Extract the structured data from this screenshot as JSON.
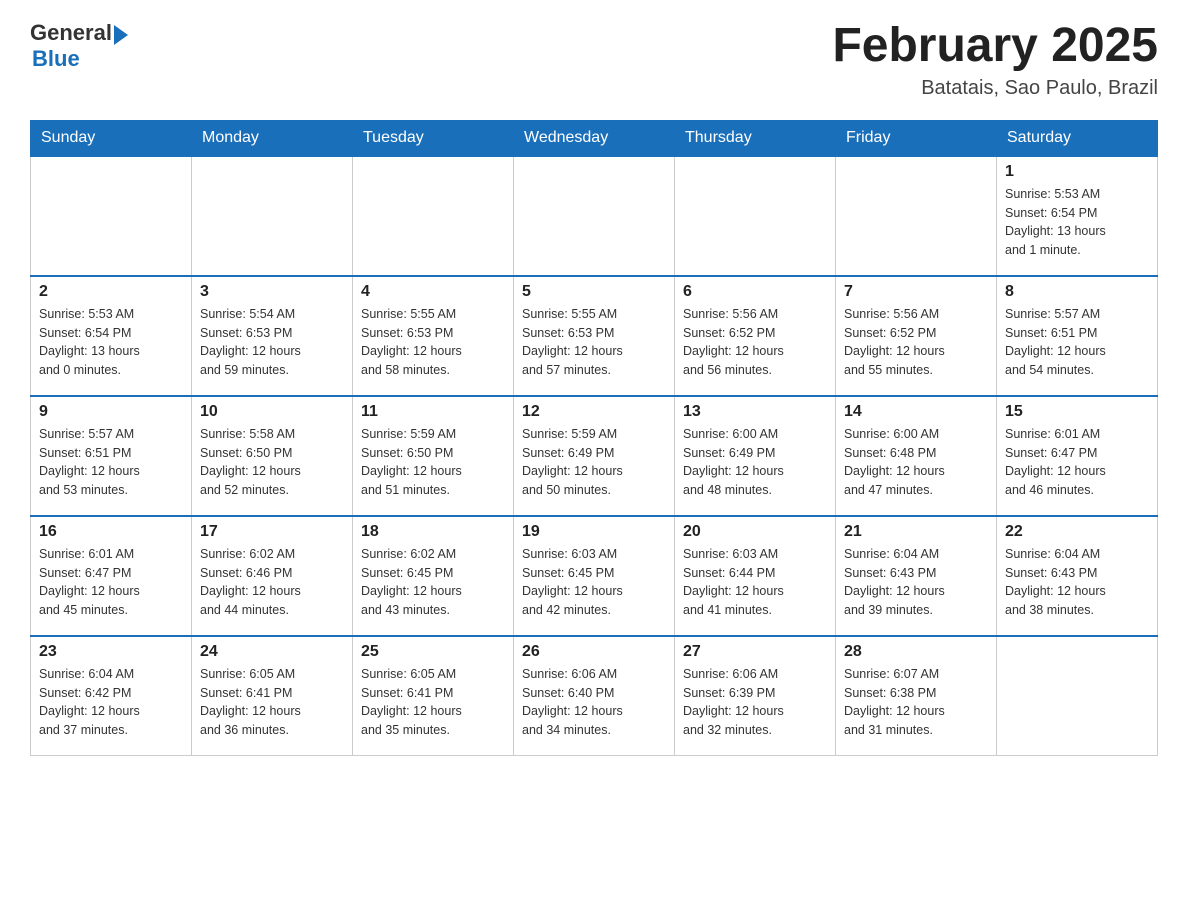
{
  "header": {
    "logo_general": "General",
    "logo_blue": "Blue",
    "month_title": "February 2025",
    "location": "Batatais, Sao Paulo, Brazil"
  },
  "days_of_week": [
    "Sunday",
    "Monday",
    "Tuesday",
    "Wednesday",
    "Thursday",
    "Friday",
    "Saturday"
  ],
  "weeks": [
    [
      {
        "day": "",
        "info": ""
      },
      {
        "day": "",
        "info": ""
      },
      {
        "day": "",
        "info": ""
      },
      {
        "day": "",
        "info": ""
      },
      {
        "day": "",
        "info": ""
      },
      {
        "day": "",
        "info": ""
      },
      {
        "day": "1",
        "info": "Sunrise: 5:53 AM\nSunset: 6:54 PM\nDaylight: 13 hours\nand 1 minute."
      }
    ],
    [
      {
        "day": "2",
        "info": "Sunrise: 5:53 AM\nSunset: 6:54 PM\nDaylight: 13 hours\nand 0 minutes."
      },
      {
        "day": "3",
        "info": "Sunrise: 5:54 AM\nSunset: 6:53 PM\nDaylight: 12 hours\nand 59 minutes."
      },
      {
        "day": "4",
        "info": "Sunrise: 5:55 AM\nSunset: 6:53 PM\nDaylight: 12 hours\nand 58 minutes."
      },
      {
        "day": "5",
        "info": "Sunrise: 5:55 AM\nSunset: 6:53 PM\nDaylight: 12 hours\nand 57 minutes."
      },
      {
        "day": "6",
        "info": "Sunrise: 5:56 AM\nSunset: 6:52 PM\nDaylight: 12 hours\nand 56 minutes."
      },
      {
        "day": "7",
        "info": "Sunrise: 5:56 AM\nSunset: 6:52 PM\nDaylight: 12 hours\nand 55 minutes."
      },
      {
        "day": "8",
        "info": "Sunrise: 5:57 AM\nSunset: 6:51 PM\nDaylight: 12 hours\nand 54 minutes."
      }
    ],
    [
      {
        "day": "9",
        "info": "Sunrise: 5:57 AM\nSunset: 6:51 PM\nDaylight: 12 hours\nand 53 minutes."
      },
      {
        "day": "10",
        "info": "Sunrise: 5:58 AM\nSunset: 6:50 PM\nDaylight: 12 hours\nand 52 minutes."
      },
      {
        "day": "11",
        "info": "Sunrise: 5:59 AM\nSunset: 6:50 PM\nDaylight: 12 hours\nand 51 minutes."
      },
      {
        "day": "12",
        "info": "Sunrise: 5:59 AM\nSunset: 6:49 PM\nDaylight: 12 hours\nand 50 minutes."
      },
      {
        "day": "13",
        "info": "Sunrise: 6:00 AM\nSunset: 6:49 PM\nDaylight: 12 hours\nand 48 minutes."
      },
      {
        "day": "14",
        "info": "Sunrise: 6:00 AM\nSunset: 6:48 PM\nDaylight: 12 hours\nand 47 minutes."
      },
      {
        "day": "15",
        "info": "Sunrise: 6:01 AM\nSunset: 6:47 PM\nDaylight: 12 hours\nand 46 minutes."
      }
    ],
    [
      {
        "day": "16",
        "info": "Sunrise: 6:01 AM\nSunset: 6:47 PM\nDaylight: 12 hours\nand 45 minutes."
      },
      {
        "day": "17",
        "info": "Sunrise: 6:02 AM\nSunset: 6:46 PM\nDaylight: 12 hours\nand 44 minutes."
      },
      {
        "day": "18",
        "info": "Sunrise: 6:02 AM\nSunset: 6:45 PM\nDaylight: 12 hours\nand 43 minutes."
      },
      {
        "day": "19",
        "info": "Sunrise: 6:03 AM\nSunset: 6:45 PM\nDaylight: 12 hours\nand 42 minutes."
      },
      {
        "day": "20",
        "info": "Sunrise: 6:03 AM\nSunset: 6:44 PM\nDaylight: 12 hours\nand 41 minutes."
      },
      {
        "day": "21",
        "info": "Sunrise: 6:04 AM\nSunset: 6:43 PM\nDaylight: 12 hours\nand 39 minutes."
      },
      {
        "day": "22",
        "info": "Sunrise: 6:04 AM\nSunset: 6:43 PM\nDaylight: 12 hours\nand 38 minutes."
      }
    ],
    [
      {
        "day": "23",
        "info": "Sunrise: 6:04 AM\nSunset: 6:42 PM\nDaylight: 12 hours\nand 37 minutes."
      },
      {
        "day": "24",
        "info": "Sunrise: 6:05 AM\nSunset: 6:41 PM\nDaylight: 12 hours\nand 36 minutes."
      },
      {
        "day": "25",
        "info": "Sunrise: 6:05 AM\nSunset: 6:41 PM\nDaylight: 12 hours\nand 35 minutes."
      },
      {
        "day": "26",
        "info": "Sunrise: 6:06 AM\nSunset: 6:40 PM\nDaylight: 12 hours\nand 34 minutes."
      },
      {
        "day": "27",
        "info": "Sunrise: 6:06 AM\nSunset: 6:39 PM\nDaylight: 12 hours\nand 32 minutes."
      },
      {
        "day": "28",
        "info": "Sunrise: 6:07 AM\nSunset: 6:38 PM\nDaylight: 12 hours\nand 31 minutes."
      },
      {
        "day": "",
        "info": ""
      }
    ]
  ]
}
